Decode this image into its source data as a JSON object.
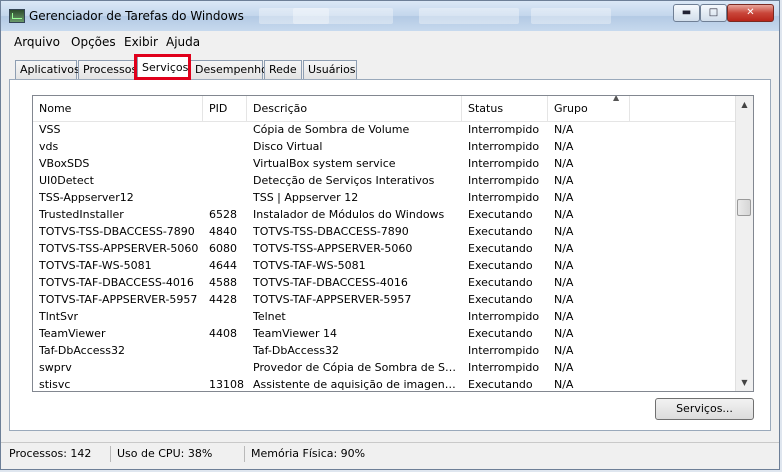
{
  "window": {
    "title": "Gerenciador de Tarefas do Windows"
  },
  "menu": [
    "Arquivo",
    "Opções",
    "Exibir",
    "Ajuda"
  ],
  "tabs": [
    "Aplicativos",
    "Processos",
    "Serviços",
    "Desempenho",
    "Rede",
    "Usuários"
  ],
  "active_tab": "Serviços",
  "highlight_color": "#e0001b",
  "columns": [
    "Nome",
    "PID",
    "Descrição",
    "Status",
    "Grupo"
  ],
  "rows": [
    [
      "VSS",
      "",
      "Cópia de Sombra de Volume",
      "Interrompido",
      "N/A"
    ],
    [
      "vds",
      "",
      "Disco Virtual",
      "Interrompido",
      "N/A"
    ],
    [
      "VBoxSDS",
      "",
      "VirtualBox system service",
      "Interrompido",
      "N/A"
    ],
    [
      "UI0Detect",
      "",
      "Detecção de Serviços Interativos",
      "Interrompido",
      "N/A"
    ],
    [
      "TSS-Appserver12",
      "",
      "TSS | Appserver 12",
      "Interrompido",
      "N/A"
    ],
    [
      "TrustedInstaller",
      "6528",
      "Instalador de Módulos do Windows",
      "Executando",
      "N/A"
    ],
    [
      "TOTVS-TSS-DBACCESS-7890",
      "4840",
      "TOTVS-TSS-DBACCESS-7890",
      "Executando",
      "N/A"
    ],
    [
      "TOTVS-TSS-APPSERVER-5060",
      "6080",
      "TOTVS-TSS-APPSERVER-5060",
      "Executando",
      "N/A"
    ],
    [
      "TOTVS-TAF-WS-5081",
      "4644",
      "TOTVS-TAF-WS-5081",
      "Executando",
      "N/A"
    ],
    [
      "TOTVS-TAF-DBACCESS-4016",
      "4588",
      "TOTVS-TAF-DBACCESS-4016",
      "Executando",
      "N/A"
    ],
    [
      "TOTVS-TAF-APPSERVER-5957",
      "4428",
      "TOTVS-TAF-APPSERVER-5957",
      "Executando",
      "N/A"
    ],
    [
      "TlntSvr",
      "",
      "Telnet",
      "Interrompido",
      "N/A"
    ],
    [
      "TeamViewer",
      "4408",
      "TeamViewer 14",
      "Executando",
      "N/A"
    ],
    [
      "Taf-DbAccess32",
      "",
      "Taf-DbAccess32",
      "Interrompido",
      "N/A"
    ],
    [
      "swprv",
      "",
      "Provedor de Cópia de Sombra de Softw...",
      "Interrompido",
      "N/A"
    ],
    [
      "stisvc",
      "13108",
      "Assistente de aquisição de imagens do ...",
      "Executando",
      "N/A"
    ]
  ],
  "services_button": "Serviços...",
  "status": {
    "processes": "Processos: 142",
    "cpu": "Uso de CPU: 38%",
    "memory": "Memória Física: 90%"
  }
}
